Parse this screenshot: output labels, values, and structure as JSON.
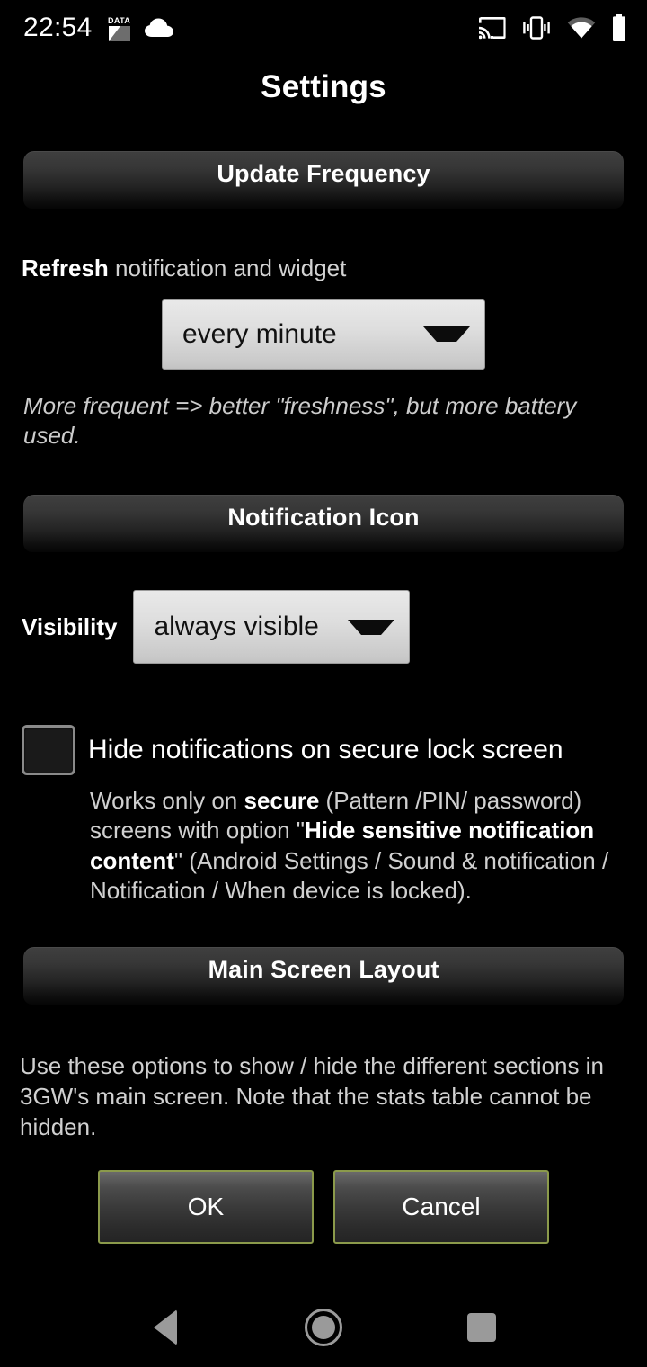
{
  "status_bar": {
    "clock": "22:54",
    "data_icon_label": "DATA",
    "icons": {
      "data": "mobile-data-icon",
      "cloud": "cloud-icon",
      "cast": "cast-icon",
      "vibrate": "vibrate-icon",
      "wifi": "wifi-icon",
      "battery": "battery-icon"
    }
  },
  "header": {
    "title": "Settings"
  },
  "sections": {
    "update_frequency": {
      "header_label": "Update Frequency",
      "refresh_label_bold": "Refresh",
      "refresh_label_rest": " notification and widget",
      "refresh_value": "every minute",
      "hint": "More frequent => better \"freshness\", but more battery used."
    },
    "notification_icon": {
      "header_label": "Notification Icon",
      "visibility_label": "Visibility",
      "visibility_value": "always visible",
      "hide_checkbox_label": "Hide notifications on secure lock screen",
      "hide_checkbox_checked": false,
      "hide_desc_1": "Works only on ",
      "hide_desc_bold_1": "secure",
      "hide_desc_2": " (Pattern /PIN/ password) screens with option \"",
      "hide_desc_bold_2": "Hide sensitive notification content",
      "hide_desc_3": "\" (Android Settings / Sound & notification / Notification / When device is locked)."
    },
    "main_screen_layout": {
      "header_label": "Main Screen Layout",
      "description": "Use these options to show / hide the different sections in 3GW's main screen. Note that the stats table cannot be hidden."
    }
  },
  "buttons": {
    "ok_label": "OK",
    "cancel_label": "Cancel"
  },
  "nav_bar": {
    "back": "back-icon",
    "home": "home-icon",
    "recents": "recents-icon"
  },
  "colors": {
    "background": "#000000",
    "header_bar_top": "#3f3f3f",
    "spinner_light": "#e9e9e9",
    "button_border_olive": "#8b9a4b",
    "nav_icon": "#9a9a9a"
  }
}
